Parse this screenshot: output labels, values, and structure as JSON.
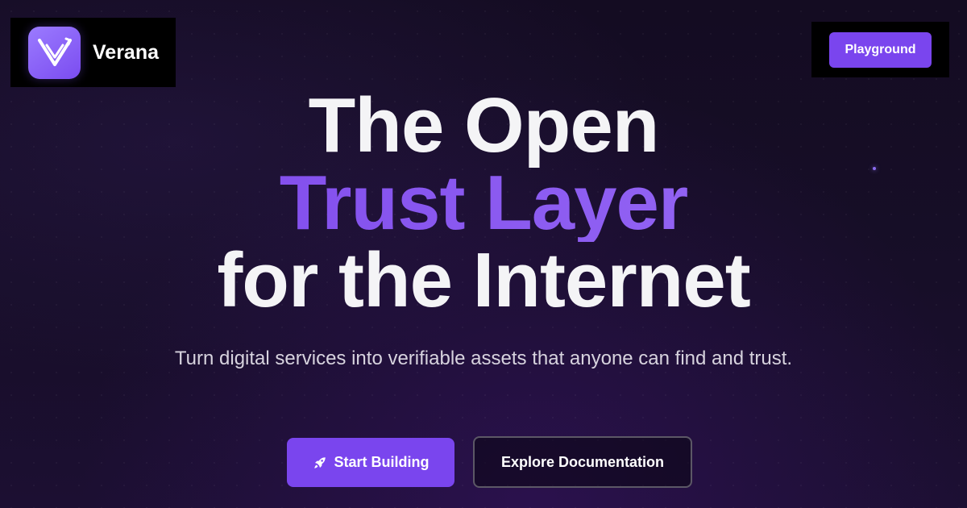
{
  "brand": {
    "name": "Verana",
    "logo_icon": "verana-v-logo-icon",
    "logo_color": "#8b5cf6"
  },
  "nav": {
    "playground_label": "Playground"
  },
  "hero": {
    "title_line1": "The Open",
    "title_line2": "Trust Layer",
    "title_line3": "for the Internet",
    "subtitle": "Turn digital services into verifiable assets that anyone can find and trust.",
    "accent_color": "#7c4bef"
  },
  "actions": {
    "start_label": "Start Building",
    "start_icon": "rocket-icon",
    "docs_label": "Explore Documentation"
  },
  "colors": {
    "background": "#160d26",
    "button_primary": "#7a45ee"
  }
}
